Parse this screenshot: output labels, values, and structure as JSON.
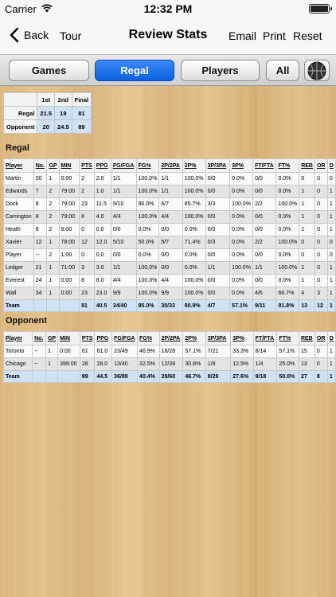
{
  "status": {
    "carrier": "Carrier",
    "time": "12:32 PM"
  },
  "nav": {
    "back": "Back",
    "tour": "Tour",
    "title": "Review Stats",
    "email": "Email",
    "print": "Print",
    "reset": "Reset"
  },
  "tabs": {
    "games": "Games",
    "regal": "Regal",
    "players": "Players",
    "all": "All",
    "active": "Regal"
  },
  "scoreboard": {
    "headers": [
      "",
      "1st",
      "2nd",
      "Final"
    ],
    "rows": [
      {
        "team": "Regal",
        "first": "21.5",
        "second": "19",
        "final": "81"
      },
      {
        "team": "Opponent",
        "first": "20",
        "second": "24.5",
        "final": "89"
      }
    ]
  },
  "columns": [
    "Player",
    "No.",
    "GP",
    "MIN",
    "PTS",
    "PPG",
    "FG/FGA",
    "FG%",
    "2P/2PA",
    "2P%",
    "3P/3PA",
    "3P%",
    "FT/FTA",
    "FT%",
    "REB",
    "OR",
    "D"
  ],
  "regal": {
    "title": "Regal",
    "rows": [
      [
        "Martin",
        "00",
        "1",
        "0:00",
        "2",
        "2.0",
        "1/1",
        "100.0%",
        "1/1",
        "100.0%",
        "0/0",
        "0.0%",
        "0/0",
        "0.0%",
        "0",
        "0",
        "0"
      ],
      [
        "Edwards",
        "7",
        "2",
        "79:00",
        "2",
        "1.0",
        "1/1",
        "100.0%",
        "1/1",
        "100.0%",
        "0/0",
        "0.0%",
        "0/0",
        "0.0%",
        "1",
        "0",
        "1"
      ],
      [
        "Dock",
        "8",
        "2",
        "79:00",
        "23",
        "11.5",
        "9/10",
        "90.0%",
        "6/7",
        "85.7%",
        "3/3",
        "100.0%",
        "2/2",
        "100.0%",
        "1",
        "0",
        "1"
      ],
      [
        "Carrington",
        "8",
        "2",
        "79:00",
        "8",
        "4.0",
        "4/4",
        "100.0%",
        "4/4",
        "100.0%",
        "0/0",
        "0.0%",
        "0/0",
        "0.0%",
        "1",
        "0",
        "1"
      ],
      [
        "Heath",
        "8",
        "2",
        "8:00",
        "0",
        "0.0",
        "0/0",
        "0.0%",
        "0/0",
        "0.0%",
        "0/0",
        "0.0%",
        "0/0",
        "0.0%",
        "1",
        "0",
        "1"
      ],
      [
        "Xavier",
        "12",
        "1",
        "78:00",
        "12",
        "12.0",
        "5/10",
        "50.0%",
        "5/7",
        "71.4%",
        "0/3",
        "0.0%",
        "2/2",
        "100.0%",
        "0",
        "0",
        "0"
      ],
      [
        "Player",
        "--",
        "2",
        "1:00",
        "0",
        "0.0",
        "0/0",
        "0.0%",
        "0/0",
        "0.0%",
        "0/0",
        "0.0%",
        "0/0",
        "0.0%",
        "0",
        "0",
        "0"
      ],
      [
        "Ledger",
        "21",
        "1",
        "71:00",
        "3",
        "3.0",
        "1/1",
        "100.0%",
        "0/0",
        "0.0%",
        "1/1",
        "100.0%",
        "1/1",
        "100.0%",
        "1",
        "0",
        "1"
      ],
      [
        "Everest",
        "24",
        "1",
        "0:00",
        "8",
        "8.0",
        "4/4",
        "100.0%",
        "4/4",
        "100.0%",
        "0/0",
        "0.0%",
        "0/0",
        "0.0%",
        "1",
        "0",
        "1"
      ],
      [
        "Wall",
        "34",
        "1",
        "0:00",
        "23",
        "23.0",
        "9/9",
        "100.0%",
        "9/9",
        "100.0%",
        "0/0",
        "0.0%",
        "4/6",
        "66.7%",
        "4",
        "3",
        "1"
      ]
    ],
    "team": [
      "Team",
      "",
      "",
      "",
      "81",
      "40.5",
      "34/40",
      "85.0%",
      "30/33",
      "90.9%",
      "4/7",
      "57.1%",
      "9/11",
      "81.8%",
      "13",
      "12",
      "1"
    ]
  },
  "opponent": {
    "title": "Opponent",
    "rows": [
      [
        "Toronto",
        "--",
        "1",
        "0:00",
        "61",
        "61.0",
        "23/49",
        "46.9%",
        "16/28",
        "57.1%",
        "7/21",
        "33.3%",
        "8/14",
        "57.1%",
        "15",
        "0",
        "1"
      ],
      [
        "Chicago",
        "--",
        "1",
        "399:00",
        "28",
        "28.0",
        "13/40",
        "32.5%",
        "12/39",
        "30.8%",
        "1/8",
        "12.5%",
        "1/4",
        "25.0%",
        "13",
        "0",
        "1"
      ]
    ],
    "team": [
      "Team",
      "",
      "",
      "",
      "89",
      "44.5",
      "36/89",
      "40.4%",
      "28/60",
      "46.7%",
      "8/29",
      "27.6%",
      "9/18",
      "50.0%",
      "27",
      "8",
      "1"
    ]
  },
  "colors": {
    "accent": "#0c5fe0",
    "team_row": "#cfe1f5"
  }
}
